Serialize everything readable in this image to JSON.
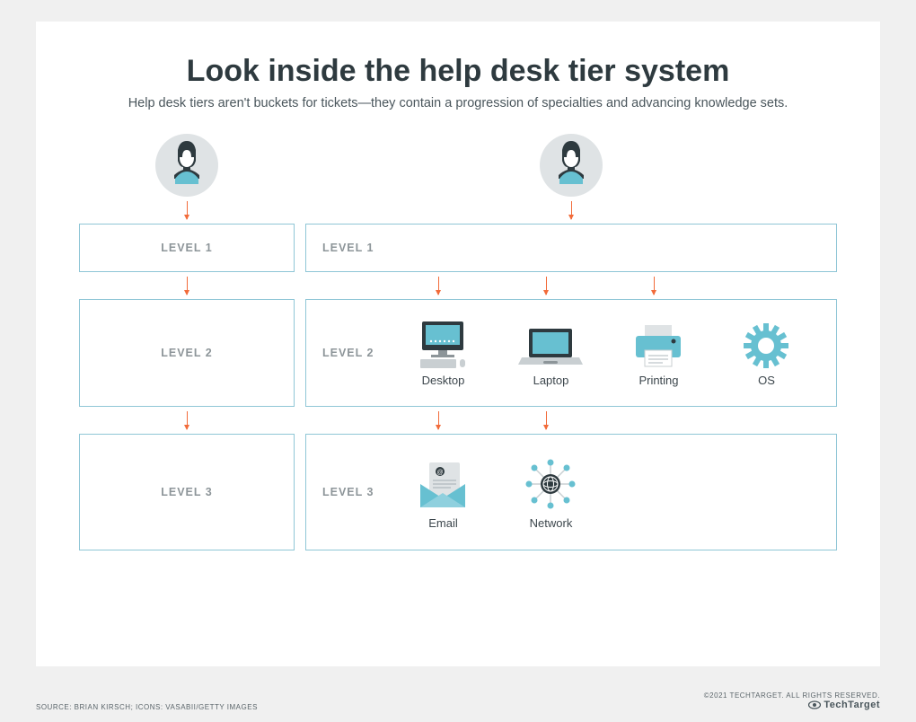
{
  "title": "Look inside the help desk tier system",
  "subtitle": "Help desk tiers aren't buckets for tickets—they contain a progression of specialties and advancing knowledge sets.",
  "left": {
    "level1": "LEVEL 1",
    "level2": "LEVEL 2",
    "level3": "LEVEL 3"
  },
  "right": {
    "level1": "LEVEL 1",
    "level2": "LEVEL 2",
    "level3": "LEVEL 3",
    "level2_specialties": [
      "Desktop",
      "Laptop",
      "Printing",
      "OS"
    ],
    "level3_specialties": [
      "Email",
      "Network"
    ]
  },
  "footer": {
    "source": "SOURCE: BRIAN KIRSCH; ICONS: VASABII/GETTY IMAGES",
    "copyright": "©2021 TECHTARGET. ALL RIGHTS RESERVED.",
    "brand": "TechTarget"
  }
}
